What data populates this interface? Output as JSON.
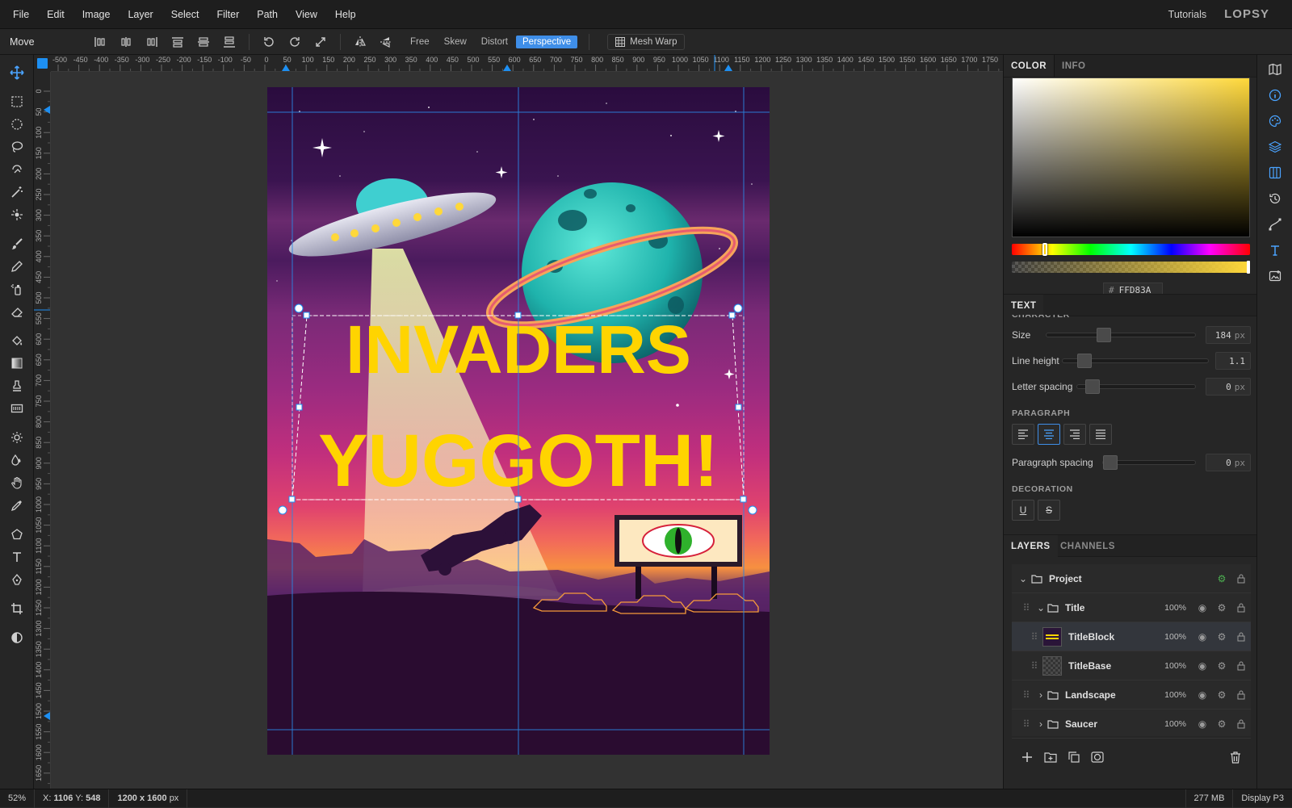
{
  "menu": {
    "items": [
      "File",
      "Edit",
      "Image",
      "Layer",
      "Select",
      "Filter",
      "Path",
      "View",
      "Help"
    ],
    "tutorials": "Tutorials",
    "logo": "LOPSY"
  },
  "options": {
    "tool_name": "Move",
    "transform_modes": [
      "Free",
      "Skew",
      "Distort",
      "Perspective"
    ],
    "active_mode": "Perspective",
    "mesh_warp": "Mesh Warp"
  },
  "rulers": {
    "h_ticks": [
      "-500",
      "-450",
      "-400",
      "-350",
      "-300",
      "-250",
      "-200",
      "-150",
      "-100",
      "-50",
      "0",
      "50",
      "100",
      "150",
      "200",
      "250",
      "300",
      "350",
      "400",
      "450",
      "500",
      "550",
      "600",
      "650",
      "700",
      "750",
      "800",
      "850",
      "900",
      "950",
      "1000",
      "1050",
      "1100",
      "1150",
      "1200",
      "1250",
      "1300",
      "1350",
      "1400",
      "1450",
      "1500",
      "1550",
      "1600",
      "1650",
      "1700",
      "1750"
    ],
    "v_ticks": [
      "0",
      "50",
      "100",
      "150",
      "200",
      "250",
      "300",
      "350",
      "400",
      "450",
      "500",
      "550",
      "600",
      "650",
      "700",
      "750",
      "800",
      "850",
      "900",
      "950",
      "1000",
      "1050",
      "1100",
      "1150",
      "1200",
      "1250",
      "1300",
      "1350",
      "1400",
      "1450",
      "1500",
      "1550",
      "1600",
      "1650"
    ]
  },
  "artwork": {
    "title_line1": "INVADERS",
    "title_line2": "YUGGOTH!"
  },
  "color_panel": {
    "tabs": [
      "COLOR",
      "INFO"
    ],
    "hex_label": "#",
    "hex": "FFD83A",
    "hue_color": "#ffd83a"
  },
  "text_panel": {
    "tab": "TEXT",
    "clipped_heading": "CHARACTER",
    "size_label": "Size",
    "size_value": "184",
    "size_unit": "px",
    "line_height_label": "Line height",
    "line_height_value": "1.1",
    "letter_spacing_label": "Letter spacing",
    "letter_spacing_value": "0",
    "letter_spacing_unit": "px",
    "paragraph_heading": "PARAGRAPH",
    "paragraph_spacing_label": "Paragraph spacing",
    "paragraph_spacing_value": "0",
    "paragraph_spacing_unit": "px",
    "decoration_heading": "DECORATION",
    "underline": "U",
    "strikethrough": "S",
    "active_alignment": "center"
  },
  "layers_panel": {
    "tabs": [
      "LAYERS",
      "CHANNELS"
    ],
    "layers": [
      {
        "name": "Project",
        "opacity": "",
        "type": "group",
        "expanded": true,
        "level": 0
      },
      {
        "name": "Title",
        "opacity": "100%",
        "type": "group",
        "expanded": true,
        "level": 1
      },
      {
        "name": "TitleBlock",
        "opacity": "100%",
        "type": "layer",
        "selected": true,
        "level": 2
      },
      {
        "name": "TitleBase",
        "opacity": "100%",
        "type": "layer",
        "level": 2
      },
      {
        "name": "Landscape",
        "opacity": "100%",
        "type": "group",
        "expanded": false,
        "level": 1
      },
      {
        "name": "Saucer",
        "opacity": "100%",
        "type": "group",
        "expanded": false,
        "level": 1
      }
    ]
  },
  "status": {
    "zoom": "52%",
    "x_label": "X:",
    "x": "1106",
    "y_label": "Y:",
    "y": "548",
    "doc_size": "1200 x 1600",
    "doc_unit": "px",
    "memory": "277 MB",
    "color_profile": "Display P3"
  }
}
